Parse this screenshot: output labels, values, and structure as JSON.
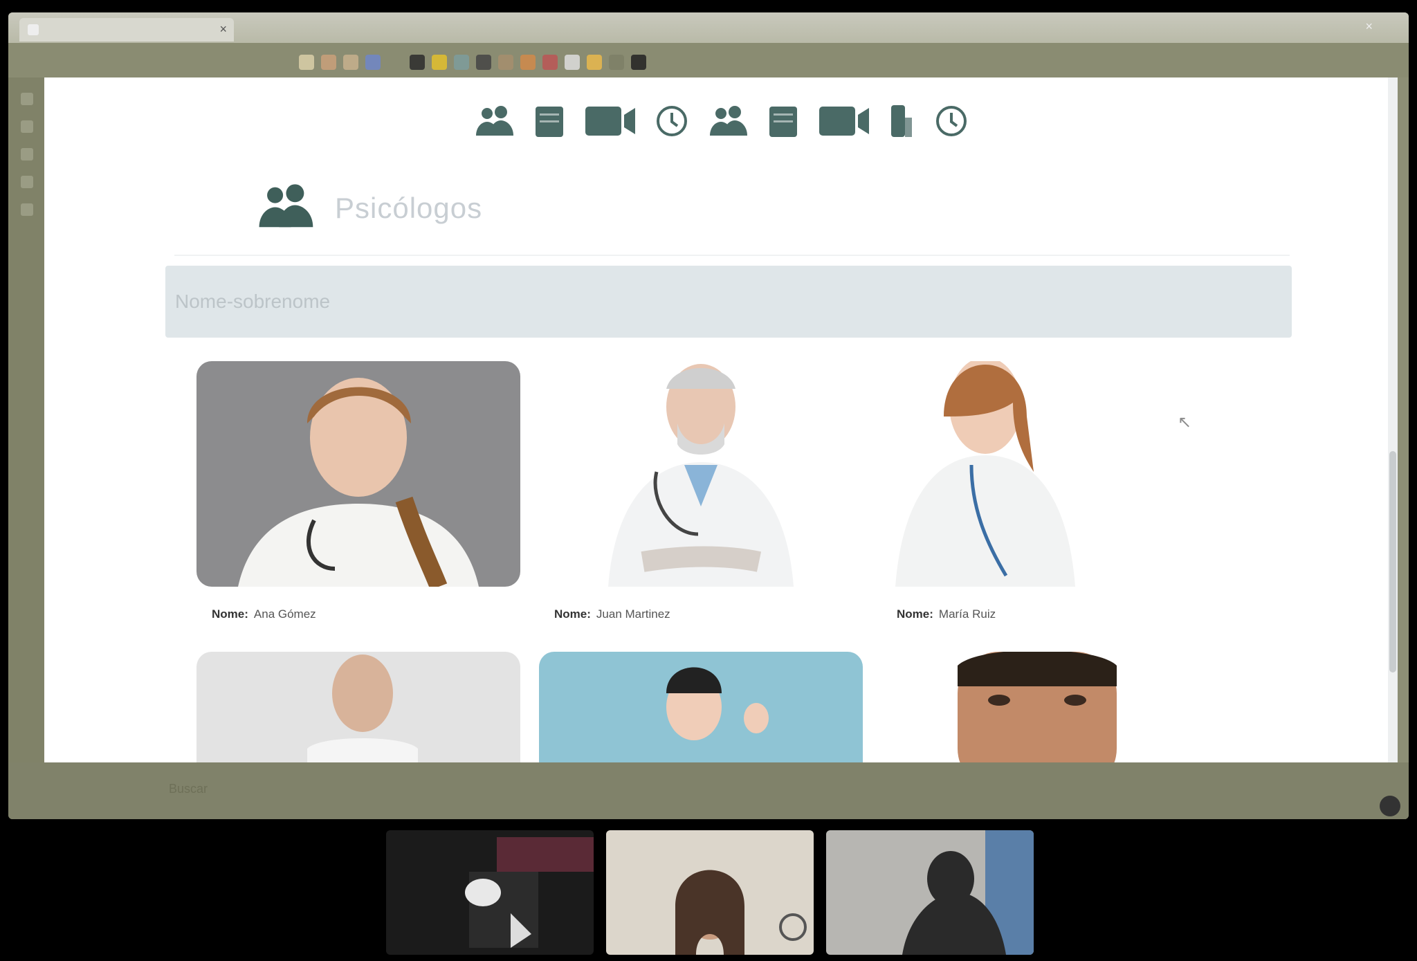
{
  "browser": {
    "tab_title": "",
    "tab_close": "×",
    "window_close": "×"
  },
  "page": {
    "title": "Psicólogos",
    "search_placeholder": "Nome-sobrenome",
    "cards": [
      {
        "label": "Nome:",
        "value": "Ana Gómez"
      },
      {
        "label": "Nome:",
        "value": "Juan Martinez"
      },
      {
        "label": "Nome:",
        "value": "María Ruiz"
      }
    ],
    "cursor": "↖"
  },
  "colors": {
    "accent": "#4a6a66",
    "search_bg": "#dfe6e9",
    "frame": "#8d8f76"
  },
  "icons": [
    "users-icon",
    "document-icon",
    "video-icon",
    "clock-icon",
    "users-icon",
    "document-icon",
    "video-icon",
    "phone-icon",
    "clock-icon"
  ],
  "taskbar": {
    "text": "Buscar"
  },
  "participants": [
    {
      "name": ""
    },
    {
      "name": ""
    },
    {
      "name": ""
    }
  ]
}
